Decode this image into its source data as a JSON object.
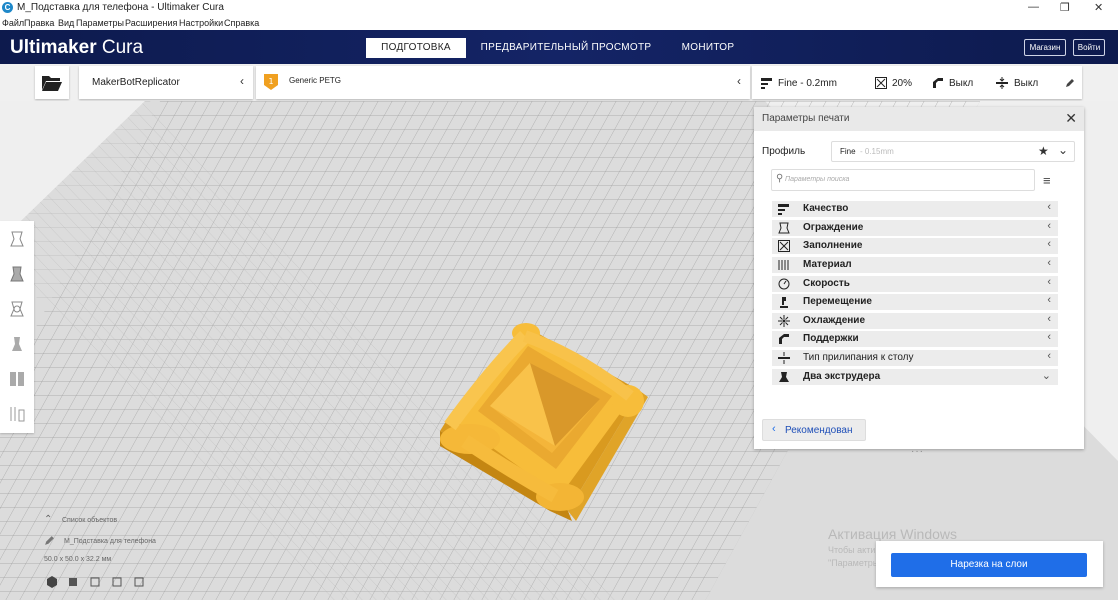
{
  "window": {
    "title": "M_Подставка для телефона - Ultimaker Cura",
    "controls": [
      "—",
      "❐",
      "✕"
    ]
  },
  "menu": [
    "Файл",
    "Правка",
    "Вид",
    "Параметры",
    "Расширения",
    "Настройки",
    "Справка"
  ],
  "header": {
    "logo_bold": "Ultimaker",
    "logo_light": "Cura",
    "tabs": [
      "ПОДГОТОВКА",
      "ПРЕДВАРИТЕЛЬНЫЙ ПРОСМОТР",
      "МОНИТОР"
    ],
    "active_tab": "ПОДГОТОВКА",
    "buttons": [
      "Магазин",
      "Войти"
    ]
  },
  "printer": {
    "name": "MakerBotReplicator",
    "material": "Generic PETG",
    "material_badge": "1"
  },
  "quick_settings": {
    "profile": "Fine - 0.2mm",
    "infill": "20%",
    "support": "Выкл",
    "adhesion": "Выкл"
  },
  "panel": {
    "title": "Параметры печати",
    "profile_label": "Профиль",
    "profile_value": "Fine",
    "profile_hint": "- 0.15mm",
    "search_placeholder": "Параметры поиска",
    "categories": [
      {
        "label": "Качество",
        "icon": "quality-icon",
        "expanded": false
      },
      {
        "label": "Ограждение",
        "icon": "shell-icon",
        "expanded": false
      },
      {
        "label": "Заполнение",
        "icon": "infill-icon",
        "expanded": false
      },
      {
        "label": "Материал",
        "icon": "material-icon",
        "expanded": false
      },
      {
        "label": "Скорость",
        "icon": "speed-icon",
        "expanded": false
      },
      {
        "label": "Перемещение",
        "icon": "travel-icon",
        "expanded": false
      },
      {
        "label": "Охлаждение",
        "icon": "cooling-icon",
        "expanded": false
      },
      {
        "label": "Поддержки",
        "icon": "support-icon",
        "expanded": false
      },
      {
        "label": "Тип прилипания к столу",
        "icon": "adhesion-icon",
        "expanded": false
      },
      {
        "label": "Два экструдера",
        "icon": "dual-extrusion-icon",
        "expanded": true
      }
    ],
    "recommended_button": "Рекомендован"
  },
  "object_info": {
    "list_label": "Список объектов",
    "object_name": "M_Подставка для телефона",
    "dimensions": "50.0 x 50.0 x 32.2 мм"
  },
  "watermark": {
    "line1": "Активация Windows",
    "line2": "Чтобы активировать Windows, перейдите в раздел",
    "line3": "\"Параметры\"."
  },
  "slice_button": "Нарезка на слои",
  "colors": {
    "header_bg": "#0d1a4d",
    "model_yellow": "#f7bd3a",
    "accent_blue": "#1f6ee8"
  }
}
